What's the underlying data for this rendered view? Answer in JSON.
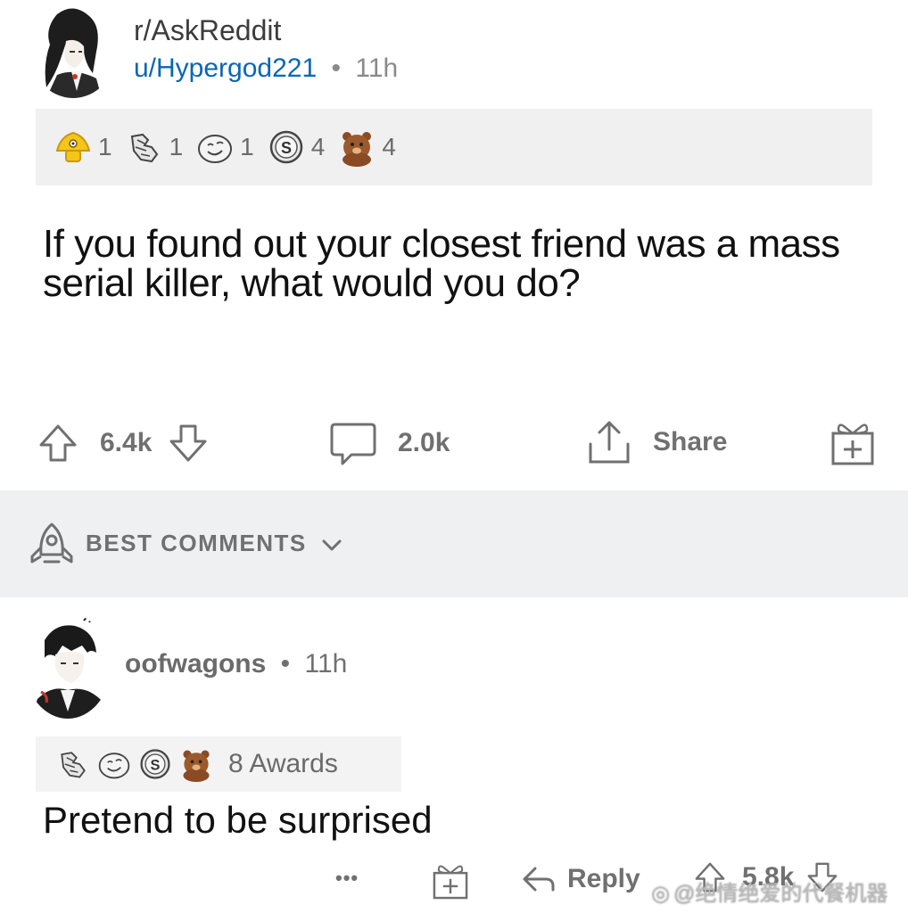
{
  "post": {
    "subreddit": "r/AskReddit",
    "author": "u/Hypergod221",
    "separator": "•",
    "age": "11h",
    "awards": [
      {
        "icon": "helpful-award-icon",
        "count": "1"
      },
      {
        "icon": "wholesome-hands-award-icon",
        "count": "1"
      },
      {
        "icon": "laughing-face-award-icon",
        "count": "1"
      },
      {
        "icon": "silver-coin-award-icon",
        "count": "4"
      },
      {
        "icon": "bear-hug-award-icon",
        "count": "4"
      }
    ],
    "title": "If you found out your closest friend was a mass serial killer, what would you do?",
    "upvotes": "6.4k",
    "comments": "2.0k",
    "share_label": "Share"
  },
  "best_comments": {
    "label": "BEST COMMENTS"
  },
  "comment": {
    "author": "oofwagons",
    "separator": "•",
    "age": "11h",
    "awards_label": "8 Awards",
    "body": "Pretend to be surprised",
    "more": "•••",
    "reply_label": "Reply",
    "score": "5.8k"
  },
  "watermark": "@绝情绝爱的代餐机器",
  "colors": {
    "link_blue": "#0a66b5",
    "muted_gray": "#707070",
    "award_bar": "#f0f0f0",
    "section_bar": "#eef0f1"
  }
}
